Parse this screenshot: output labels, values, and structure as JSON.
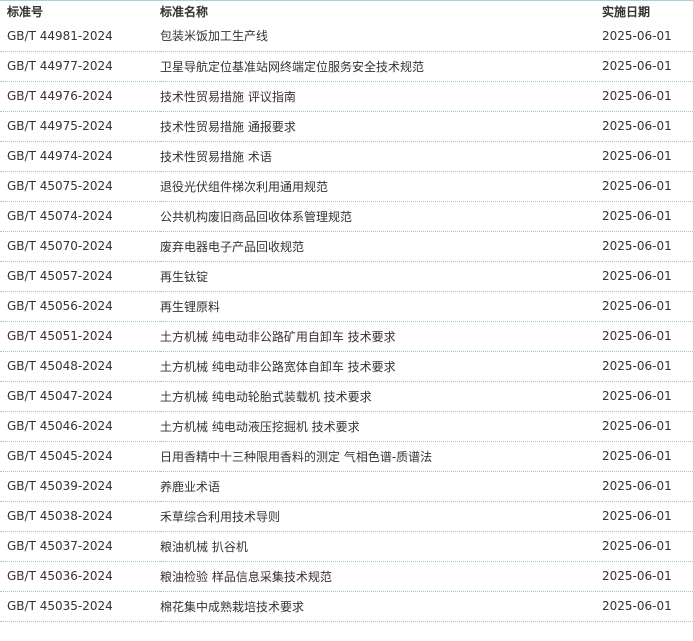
{
  "table": {
    "headers": {
      "code": "标准号",
      "name": "标准名称",
      "date": "实施日期"
    },
    "rows": [
      {
        "code": "GB/T 44981-2024",
        "name": "包装米饭加工生产线",
        "date": "2025-06-01"
      },
      {
        "code": "GB/T 44977-2024",
        "name": "卫星导航定位基准站网终端定位服务安全技术规范",
        "date": "2025-06-01"
      },
      {
        "code": "GB/T 44976-2024",
        "name": "技术性贸易措施 评议指南",
        "date": "2025-06-01"
      },
      {
        "code": "GB/T 44975-2024",
        "name": "技术性贸易措施 通报要求",
        "date": "2025-06-01"
      },
      {
        "code": "GB/T 44974-2024",
        "name": "技术性贸易措施 术语",
        "date": "2025-06-01"
      },
      {
        "code": "GB/T 45075-2024",
        "name": "退役光伏组件梯次利用通用规范",
        "date": "2025-06-01"
      },
      {
        "code": "GB/T 45074-2024",
        "name": "公共机构废旧商品回收体系管理规范",
        "date": "2025-06-01"
      },
      {
        "code": "GB/T 45070-2024",
        "name": "废弃电器电子产品回收规范",
        "date": "2025-06-01"
      },
      {
        "code": "GB/T 45057-2024",
        "name": "再生钛锭",
        "date": "2025-06-01"
      },
      {
        "code": "GB/T 45056-2024",
        "name": "再生锂原料",
        "date": "2025-06-01"
      },
      {
        "code": "GB/T 45051-2024",
        "name": "土方机械 纯电动非公路矿用自卸车 技术要求",
        "date": "2025-06-01"
      },
      {
        "code": "GB/T 45048-2024",
        "name": "土方机械 纯电动非公路宽体自卸车 技术要求",
        "date": "2025-06-01"
      },
      {
        "code": "GB/T 45047-2024",
        "name": "土方机械 纯电动轮胎式装载机 技术要求",
        "date": "2025-06-01"
      },
      {
        "code": "GB/T 45046-2024",
        "name": "土方机械 纯电动液压挖掘机 技术要求",
        "date": "2025-06-01"
      },
      {
        "code": "GB/T 45045-2024",
        "name": "日用香精中十三种限用香料的测定 气相色谱-质谱法",
        "date": "2025-06-01"
      },
      {
        "code": "GB/T 45039-2024",
        "name": "养鹿业术语",
        "date": "2025-06-01"
      },
      {
        "code": "GB/T 45038-2024",
        "name": "禾草综合利用技术导则",
        "date": "2025-06-01"
      },
      {
        "code": "GB/T 45037-2024",
        "name": "粮油机械 扒谷机",
        "date": "2025-06-01"
      },
      {
        "code": "GB/T 45036-2024",
        "name": "粮油检验 样品信息采集技术规范",
        "date": "2025-06-01"
      },
      {
        "code": "GB/T 45035-2024",
        "name": "棉花集中成熟栽培技术要求",
        "date": "2025-06-01"
      }
    ]
  }
}
